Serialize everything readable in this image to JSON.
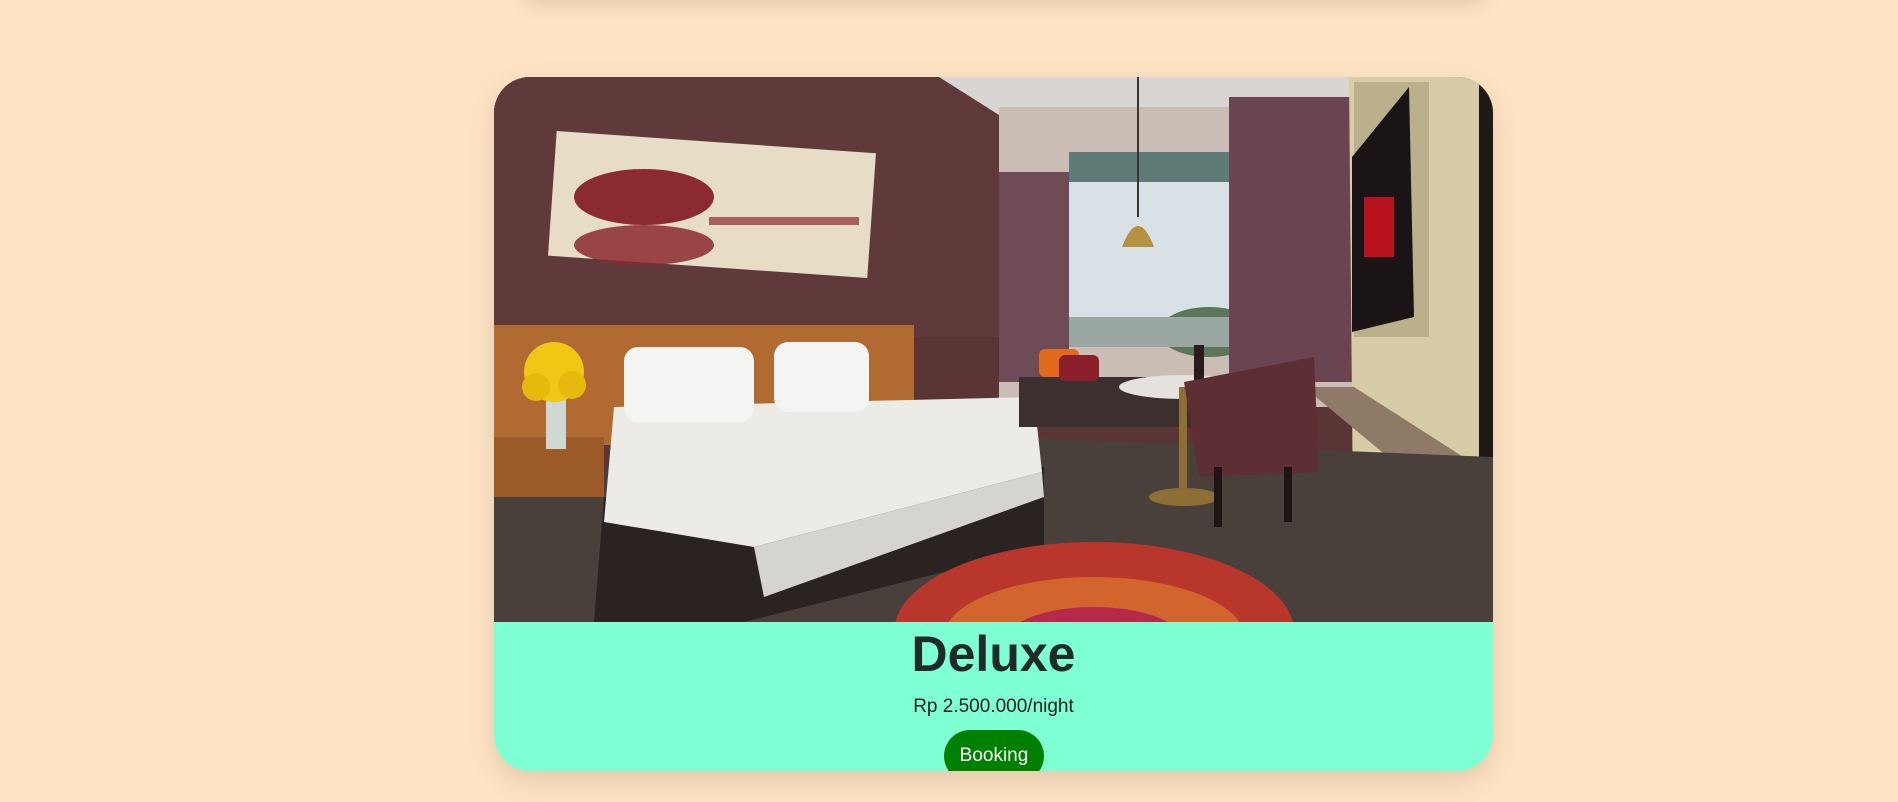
{
  "room": {
    "name": "Deluxe",
    "price": "Rp 2.500.000/night",
    "booking_label": "Booking",
    "image_alt": "Deluxe room photo"
  },
  "colors": {
    "page_background": "#ffe4c4",
    "card_info_background": "#7fffd4",
    "booking_button": "#008000"
  }
}
